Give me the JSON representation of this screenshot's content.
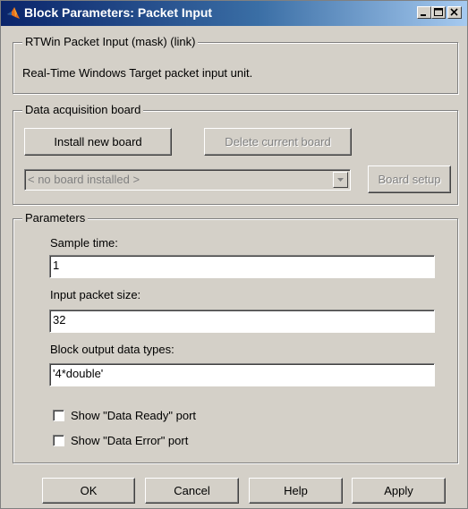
{
  "window": {
    "title": "Block Parameters: Packet Input"
  },
  "mask": {
    "legend": "RTWin Packet Input (mask) (link)",
    "description": "Real-Time Windows Target packet input unit."
  },
  "daq": {
    "legend": "Data acquisition board",
    "install_label": "Install new board",
    "delete_label": "Delete current board",
    "board_select_value": "< no board installed >",
    "setup_label": "Board setup"
  },
  "params": {
    "legend": "Parameters",
    "sample_time_label": "Sample time:",
    "sample_time_value": "1",
    "packet_size_label": "Input packet size:",
    "packet_size_value": "32",
    "output_types_label": "Block output data types:",
    "output_types_value": "'4*double'",
    "ready_port_label": "Show \"Data Ready\" port",
    "ready_port_checked": false,
    "error_port_label": "Show \"Data Error\" port",
    "error_port_checked": false
  },
  "buttons": {
    "ok": "OK",
    "cancel": "Cancel",
    "help": "Help",
    "apply": "Apply"
  },
  "icons": {
    "title_icon": "matlab-logo-icon",
    "minimize": "minimize-icon",
    "maximize": "maximize-icon",
    "close": "close-icon",
    "dropdown": "chevron-down-icon"
  }
}
